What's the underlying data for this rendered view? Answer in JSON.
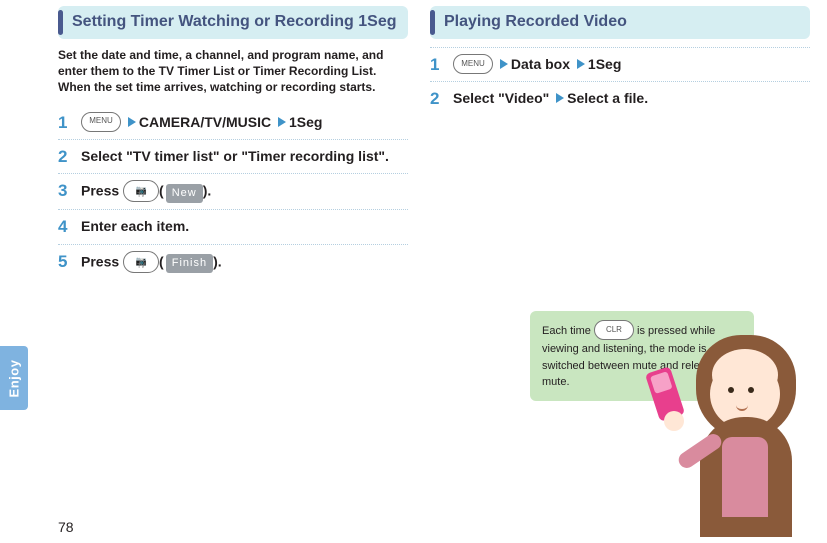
{
  "page_number": "78",
  "sidebar_label": "Enjoy",
  "left": {
    "title": "Setting Timer Watching or Recording 1Seg",
    "intro": "Set the date and time, a channel, and program name, and enter them to the TV Timer List or Timer Recording List. When the set time arrives, watching or recording starts.",
    "steps": {
      "s1": {
        "num": "1",
        "nav1": "CAMERA/TV/MUSIC",
        "nav2": "1Seg"
      },
      "s2": {
        "num": "2",
        "text": "Select \"TV timer list\" or \"Timer recording list\"."
      },
      "s3": {
        "num": "3",
        "prefix": "Press ",
        "soft": "New",
        "suffix": "."
      },
      "s4": {
        "num": "4",
        "text": "Enter each item."
      },
      "s5": {
        "num": "5",
        "prefix": "Press ",
        "soft": "Finish",
        "suffix": "."
      }
    }
  },
  "right": {
    "title": "Playing Recorded Video",
    "steps": {
      "s1": {
        "num": "1",
        "nav1": "Data box",
        "nav2": "1Seg"
      },
      "s2": {
        "num": "2",
        "text_a": "Select \"Video\"",
        "text_b": "Select a file."
      }
    },
    "tip_a": "Each time ",
    "tip_b": " is pressed while viewing and listening, the mode is switched between mute and release mute."
  }
}
